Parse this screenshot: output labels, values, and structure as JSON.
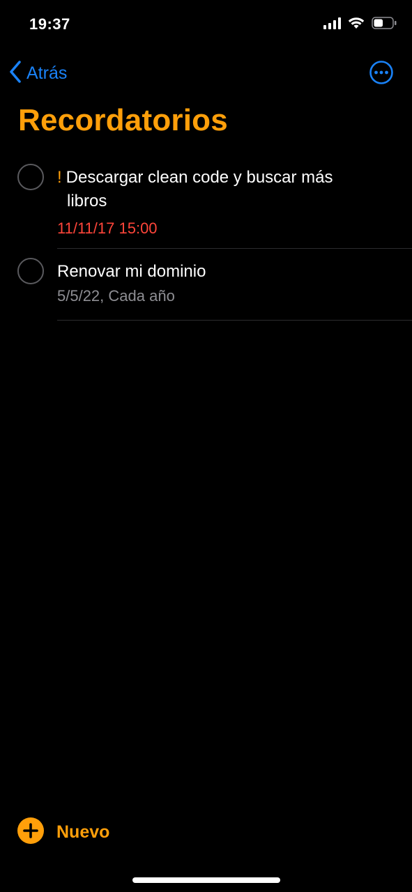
{
  "status_bar": {
    "time": "19:37",
    "icons": [
      "cellular-signal-icon",
      "wifi-icon",
      "battery-icon"
    ],
    "battery_level": 0.5
  },
  "nav": {
    "back_label": "Atrás",
    "back_icon": "chevron-left-icon",
    "more_icon": "ellipsis-circle-icon"
  },
  "page_title": "Recordatorios",
  "reminders": [
    {
      "priority": "!",
      "title_line1": "Descargar clean code y buscar más",
      "title_line2": "libros",
      "meta": "11/11/17 15:00",
      "overdue": true
    },
    {
      "priority": "",
      "title_line1": "Renovar mi dominio",
      "title_line2": "",
      "meta": "5/5/22, Cada año",
      "overdue": false
    }
  ],
  "footer": {
    "new_label": "Nuevo",
    "new_icon": "plus-circle-icon"
  },
  "colors": {
    "accent_orange": "#ff9f0a",
    "link_blue": "#1a82f7",
    "overdue_red": "#ff453a",
    "secondary_gray": "#8e8e93",
    "background": "#000000"
  }
}
